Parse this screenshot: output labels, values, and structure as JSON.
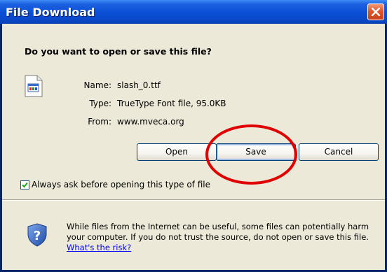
{
  "window": {
    "title": "File Download",
    "title_bar_color": "#0a4fd6",
    "close_button_color": "#e3552a"
  },
  "dialog": {
    "question": "Do you want to open or save this file?",
    "file_info": {
      "name_label": "Name:",
      "name_value": "slash_0.ttf",
      "type_label": "Type:",
      "type_value": "TrueType Font file, 95.0KB",
      "from_label": "From:",
      "from_value": "www.mveca.org"
    },
    "buttons": {
      "open": "Open",
      "save": "Save",
      "cancel": "Cancel"
    },
    "checkbox": {
      "label": "Always ask before opening this type of file",
      "checked": true
    },
    "warning": {
      "text": "While files from the Internet can be useful, some files can potentially harm your computer. If you do not trust the source, do not open or save this file.",
      "link_text": "What's the risk?"
    },
    "annotation_color": "#e00000"
  }
}
